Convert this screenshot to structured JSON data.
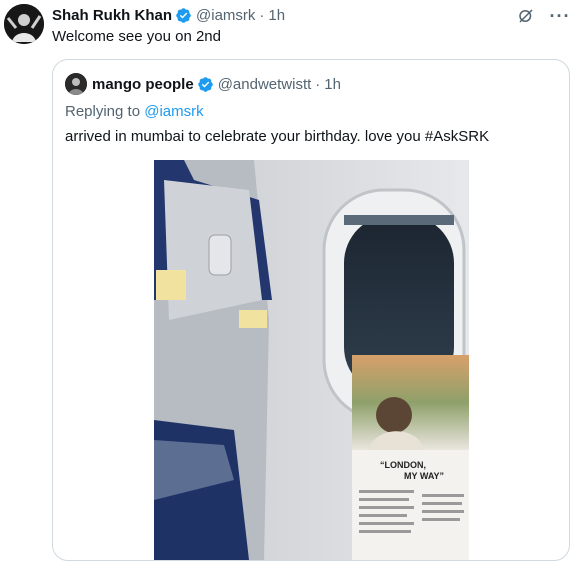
{
  "tweet": {
    "author_name": "Shah Rukh Khan",
    "author_handle": "@iamsrk",
    "time": "1h",
    "text": "Welcome see you on 2nd"
  },
  "quoted": {
    "author_name": "mango people",
    "author_handle": "@andwetwistt",
    "time": "1h",
    "replying_prefix": "Replying to",
    "replying_handle": "@iamsrk",
    "text": "arrived in mumbai to celebrate your birthday. love you #AskSRK",
    "media": {
      "magazine_headline_1": "“LONDON,",
      "magazine_headline_2": "MY WAY”"
    }
  },
  "icons": {
    "verified": "verified-badge-icon",
    "grok": "grok-icon",
    "more": "more-icon"
  },
  "colors": {
    "accent": "#1d9bf0",
    "muted": "#536471",
    "border": "#cfd9de"
  }
}
